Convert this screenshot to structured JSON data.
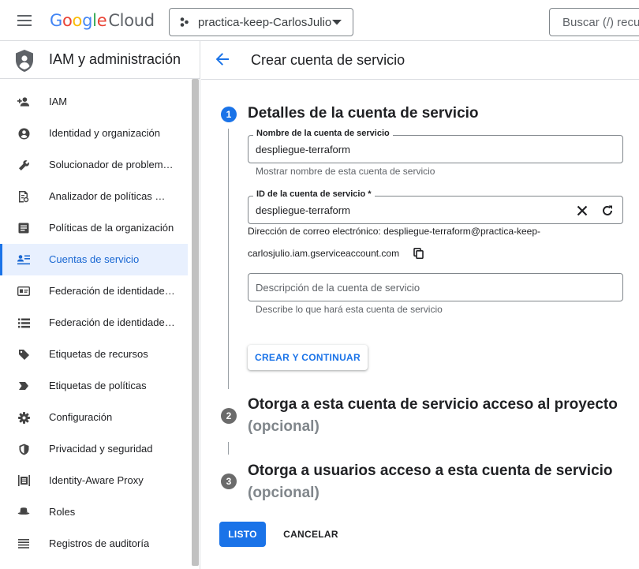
{
  "topbar": {
    "logo_letters": [
      {
        "char": "G",
        "color": "#4285F4"
      },
      {
        "char": "o",
        "color": "#EA4335"
      },
      {
        "char": "o",
        "color": "#FBBC05"
      },
      {
        "char": "g",
        "color": "#4285F4"
      },
      {
        "char": "l",
        "color": "#34A853"
      },
      {
        "char": "e",
        "color": "#EA4335"
      }
    ],
    "logo_product": "Cloud",
    "project_name": "practica-keep-CarlosJulio",
    "search_placeholder": "Buscar (/) recu"
  },
  "sidebar": {
    "title": "IAM y administración",
    "items": [
      {
        "label": "IAM",
        "icon": "person-add-icon"
      },
      {
        "label": "Identidad y organización",
        "icon": "account-circle-icon"
      },
      {
        "label": "Solucionador de problem…",
        "icon": "wrench-icon"
      },
      {
        "label": "Analizador de políticas …",
        "icon": "policy-analyzer-icon"
      },
      {
        "label": "Políticas de la organización",
        "icon": "article-icon"
      },
      {
        "label": "Cuentas de servicio",
        "icon": "service-account-icon",
        "active": true
      },
      {
        "label": "Federación de identidade…",
        "icon": "id-card-icon"
      },
      {
        "label": "Federación de identidade…",
        "icon": "list-icon"
      },
      {
        "label": "Etiquetas de recursos",
        "icon": "tag-icon"
      },
      {
        "label": "Etiquetas de políticas",
        "icon": "label-icon"
      },
      {
        "label": "Configuración",
        "icon": "gear-icon"
      },
      {
        "label": "Privacidad y seguridad",
        "icon": "shield-icon"
      },
      {
        "label": "Identity-Aware Proxy",
        "icon": "proxy-icon"
      },
      {
        "label": "Roles",
        "icon": "roles-icon"
      },
      {
        "label": "Registros de auditoría",
        "icon": "audit-log-icon"
      }
    ]
  },
  "main": {
    "page_title": "Crear cuenta de servicio",
    "step1": {
      "number": "1",
      "title": "Detalles de la cuenta de servicio",
      "name_field": {
        "label": "Nombre de la cuenta de servicio",
        "value": "despliegue-terraform",
        "hint": "Mostrar nombre de esta cuenta de servicio"
      },
      "id_field": {
        "label": "ID de la cuenta de servicio *",
        "value": "despliegue-terraform"
      },
      "email_line1": "Dirección de correo electrónico: despliegue-terraform@practica-keep-",
      "email_line2": "carlosjulio.iam.gserviceaccount.com",
      "description_field": {
        "placeholder": "Descripción de la cuenta de servicio",
        "hint": "Describe lo que hará esta cuenta de servicio"
      },
      "create_button": "CREAR Y CONTINUAR"
    },
    "step2": {
      "number": "2",
      "title": "Otorga a esta cuenta de servicio acceso al proyecto",
      "optional": "(opcional)"
    },
    "step3": {
      "number": "3",
      "title": "Otorga a usuarios acceso a esta cuenta de servicio",
      "optional": "(opcional)"
    },
    "done_button": "LISTO",
    "cancel_button": "CANCELAR"
  },
  "colors": {
    "accent": "#1a73e8",
    "active_bg": "#e8f0fe",
    "step_inactive": "#6b6b6b"
  }
}
